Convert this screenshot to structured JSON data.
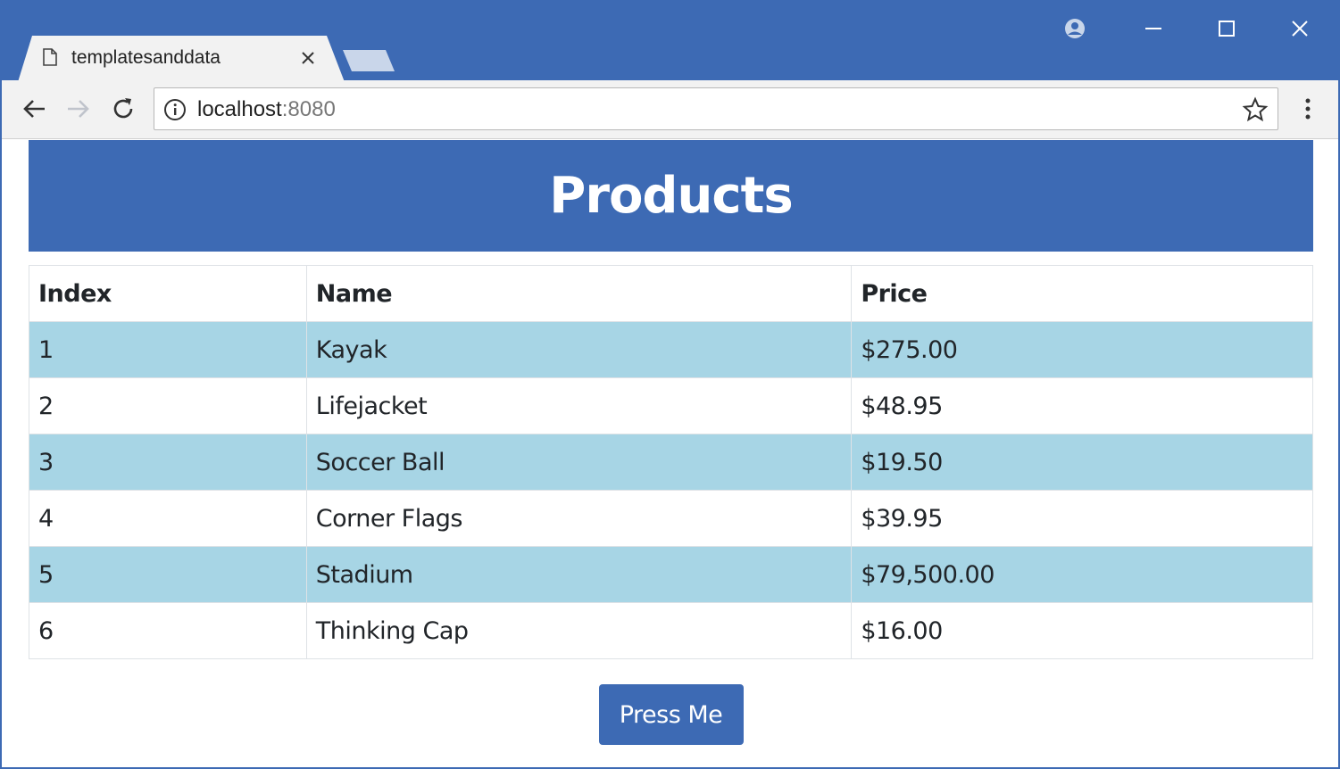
{
  "browser": {
    "tab_title": "templatesanddata",
    "url_host": "localhost",
    "url_port": ":8080",
    "accent_color": "#3d6ab4",
    "icons": [
      "page-icon",
      "close-icon",
      "profile-icon",
      "minimize-icon",
      "maximize-icon",
      "window-close-icon",
      "back-icon",
      "forward-icon",
      "reload-icon",
      "info-icon",
      "star-icon",
      "menu-icon"
    ]
  },
  "page": {
    "header_title": "Products",
    "header_color": "#3d6ab4",
    "stripe_color": "#a7d5e5",
    "table": {
      "columns": [
        "Index",
        "Name",
        "Price"
      ],
      "rows": [
        {
          "index": "1",
          "name": "Kayak",
          "price": "$275.00"
        },
        {
          "index": "2",
          "name": "Lifejacket",
          "price": "$48.95"
        },
        {
          "index": "3",
          "name": "Soccer Ball",
          "price": "$19.50"
        },
        {
          "index": "4",
          "name": "Corner Flags",
          "price": "$39.95"
        },
        {
          "index": "5",
          "name": "Stadium",
          "price": "$79,500.00"
        },
        {
          "index": "6",
          "name": "Thinking Cap",
          "price": "$16.00"
        }
      ]
    },
    "button_label": "Press Me"
  }
}
